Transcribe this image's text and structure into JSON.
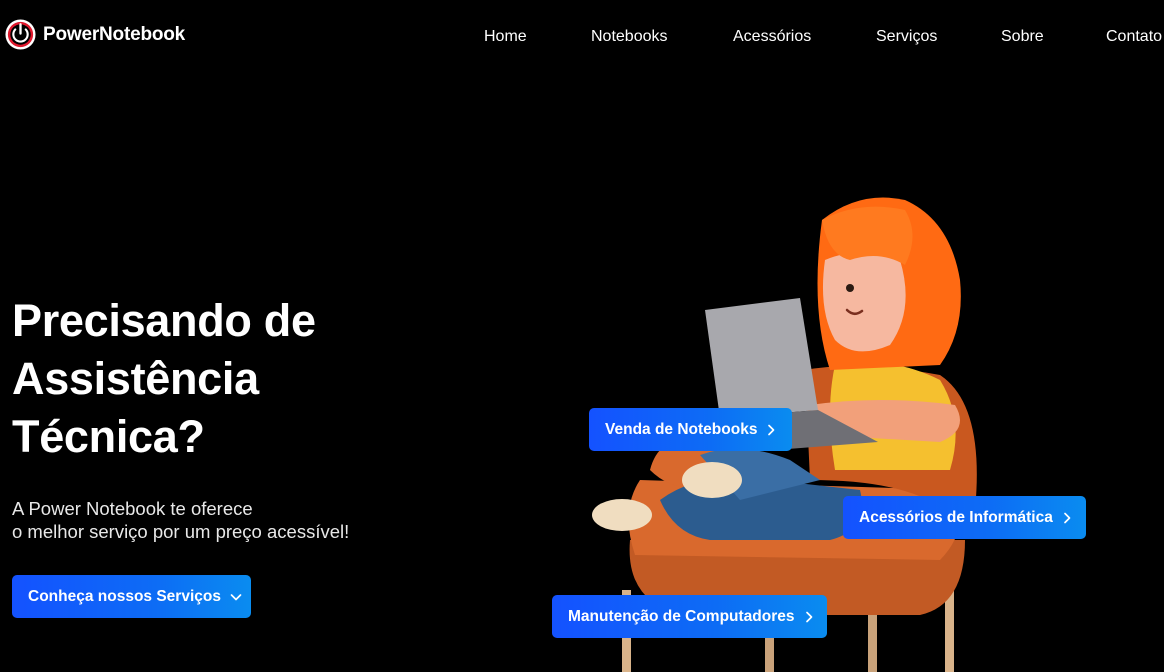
{
  "brand": {
    "name": "PowerNotebook",
    "icon": "power-icon",
    "accent": "#e0182d"
  },
  "nav": {
    "items": [
      {
        "label": "Home"
      },
      {
        "label": "Notebooks"
      },
      {
        "label": "Acessórios"
      },
      {
        "label": "Serviços"
      },
      {
        "label": "Sobre"
      },
      {
        "label": "Contato"
      }
    ]
  },
  "hero": {
    "title_lines": [
      "Precisando de",
      "Assistência",
      "Técnica?"
    ],
    "subtitle_lines": [
      "A Power Notebook te oferece",
      "o melhor serviço por um preço acessível!"
    ],
    "cta_label": "Conheça nossos Serviços",
    "cta_icon": "chevron-down-icon"
  },
  "service_tags": [
    {
      "label": "Venda de Notebooks",
      "icon": "chevron-right-icon"
    },
    {
      "label": "Acessórios de Informática",
      "icon": "chevron-right-icon"
    },
    {
      "label": "Manutenção de Computadores",
      "icon": "chevron-right-icon"
    }
  ],
  "colors": {
    "background": "#000000",
    "button_gradient_start": "#1452ff",
    "button_gradient_end": "#0a8cf0",
    "text": "#ffffff"
  }
}
